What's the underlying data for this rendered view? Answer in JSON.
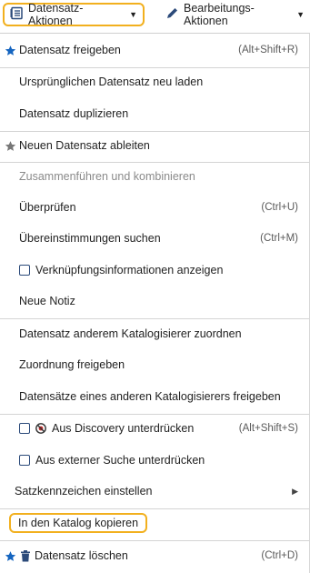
{
  "toolbar": {
    "record_actions_label": "Datensatz-Aktionen",
    "edit_actions_label": "Bearbeitungs-Aktionen"
  },
  "menu": {
    "release_record": {
      "label": "Datensatz freigeben",
      "shortcut": "(Alt+Shift+R)"
    },
    "reload_original": {
      "label": "Ursprünglichen Datensatz neu laden"
    },
    "duplicate_record": {
      "label": "Datensatz duplizieren"
    },
    "derive_record": {
      "label": "Neuen Datensatz ableiten"
    },
    "merge_combine": {
      "label": "Zusammenführen und kombinieren"
    },
    "validate": {
      "label": "Überprüfen",
      "shortcut": "(Ctrl+U)"
    },
    "find_matches": {
      "label": "Übereinstimmungen suchen",
      "shortcut": "(Ctrl+M)"
    },
    "show_linking_info": {
      "label": "Verknüpfungsinformationen anzeigen"
    },
    "new_note": {
      "label": "Neue Notiz"
    },
    "assign_cataloger": {
      "label": "Datensatz anderem Katalogisierer zuordnen"
    },
    "release_assignment": {
      "label": "Zuordnung freigeben"
    },
    "release_other_records": {
      "label": "Datensätze eines anderen Katalogisierers freigeben"
    },
    "suppress_discovery": {
      "label": "Aus Discovery unterdrücken",
      "shortcut": "(Alt+Shift+S)"
    },
    "suppress_external": {
      "label": "Aus externer Suche unterdrücken"
    },
    "set_record_flags": {
      "label": "Satzkennzeichen einstellen"
    },
    "copy_to_catalog": {
      "label": "In den Katalog kopieren"
    },
    "delete_record": {
      "label": "Datensatz löschen",
      "shortcut": "(Ctrl+D)"
    }
  },
  "colors": {
    "accent_highlight": "#f2b01e",
    "star_blue": "#1565c0",
    "icon_navy": "#2b4a7a"
  }
}
